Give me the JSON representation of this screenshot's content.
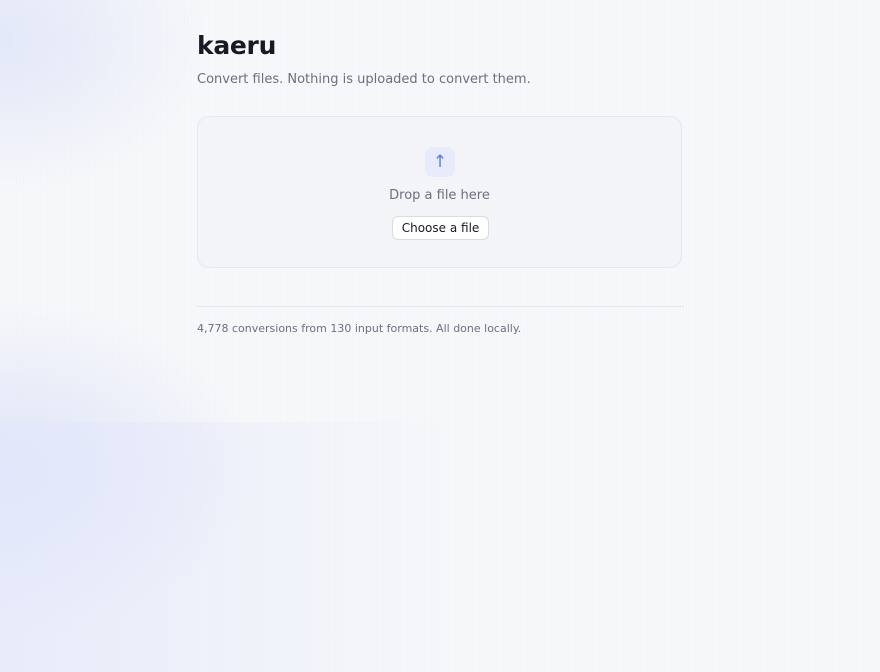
{
  "header": {
    "title": "kaeru",
    "subtitle": "Convert files. Nothing is uploaded to convert them."
  },
  "dropzone": {
    "icon": "upload-arrow-icon",
    "icon_glyph": "↑",
    "label": "Drop a file here",
    "button_label": "Choose a file"
  },
  "footer": {
    "text": "4,778 conversions from 130 input formats. All done locally."
  },
  "colors": {
    "accent": "#5b7be6",
    "text": "#161a24",
    "muted": "#6b7080",
    "background": "#f5f6f9"
  }
}
